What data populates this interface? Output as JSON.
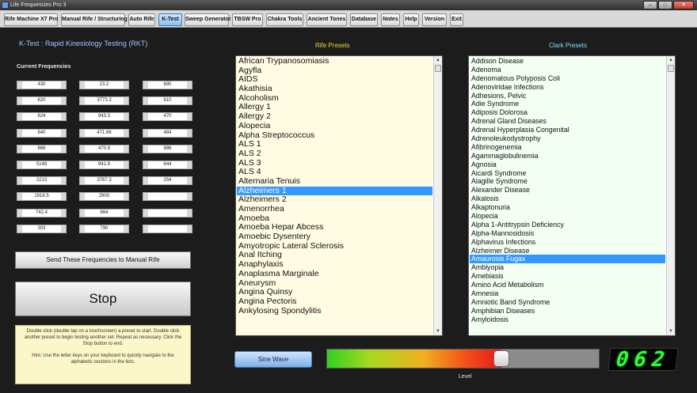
{
  "window": {
    "title": "Life Frequencies Pro 3",
    "minimize": "–",
    "maximize": "□",
    "close": "✕"
  },
  "tabs": [
    {
      "label": "Rife Machine X7 Pro"
    },
    {
      "label": "Manual Rife / Structuring"
    },
    {
      "label": "Auto Rife"
    },
    {
      "label": "K-Test",
      "active": true
    },
    {
      "label": "Sweep Generator"
    },
    {
      "label": "TBSW Pro"
    },
    {
      "label": "Chakra Tools"
    },
    {
      "label": "Ancient Tones"
    },
    {
      "label": "Database"
    },
    {
      "label": "Notes"
    },
    {
      "label": "Help"
    },
    {
      "label": "Version"
    },
    {
      "label": "Exit"
    }
  ],
  "ktest": {
    "title": "K-Test : Rapid Kinesiology Testing (RKT)",
    "current_freq_label": "Current Frequencies",
    "frequencies": [
      [
        "430",
        "23.2",
        "690"
      ],
      [
        "620",
        "3773.3",
        "610"
      ],
      [
        "624",
        "943.3",
        "470"
      ],
      [
        "840",
        "471.66",
        "484"
      ],
      [
        "866",
        "470.9",
        "986"
      ],
      [
        "5148",
        "941.8",
        "644"
      ],
      [
        "2213",
        "3767.3",
        "254"
      ],
      [
        "1918.5",
        "2900",
        ""
      ],
      [
        "742.4",
        "864",
        ""
      ],
      [
        "303",
        "790",
        ""
      ]
    ],
    "send_button": "Send These Frequencies to Manual Rife",
    "stop_button": "Stop",
    "hint_text_1": "Double click (double tap on a touchscreen) a preset to start. Double click another preset to begin testing another set. Repeat as necessary. Click the Stop button to end.",
    "hint_text_2": "Hint: Use the letter keys on your keyboard to quickly navigate to the alphabetic sections in the lists."
  },
  "rife_presets": {
    "title": "Rife Presets",
    "selected": "Alzheimers 1",
    "items": [
      "African Trypanosomiasis",
      "Agyfla",
      "AIDS",
      "Akathisia",
      "Alcoholism",
      "Allergy 1",
      "Allergy 2",
      "Alopecia",
      "Alpha Streptococcus",
      "ALS 1",
      "ALS 2",
      "ALS 3",
      "ALS 4",
      "Alternaria Tenuis",
      "Alzheimers 1",
      "Alzheimers 2",
      "Amenorrhea",
      "Amoeba",
      "Amoeba Hepar Abcess",
      "Amoebic Dysentery",
      "Amyotropic Lateral Sclerosis",
      "Anal Itching",
      "Anaphylaxis",
      "Anaplasma Marginale",
      "Aneurysm",
      "Angina Quinsy",
      "Angina Pectoris",
      "Ankylosing Spondylitis"
    ]
  },
  "clark_presets": {
    "title": "Clark Presets",
    "selected": "Amaurosis Fugax",
    "items": [
      "Addison Disease",
      "Adenoma",
      "Adenomatous Polyposis Coli",
      "Adenoviridae Infections",
      "Adhesions, Pelvic",
      "Adie Syndrome",
      "Adiposis Dolorosa",
      "Adrenal Gland Diseases",
      "Adrenal Hyperplasia Congenital",
      "Adrenoleukodystrophy",
      "Afibrinogenemia",
      "Agammaglobulinemia",
      "Agnosia",
      "Aicardi Syndrome",
      "Alagille Syndrome",
      "Alexander Disease",
      "Alkalosis",
      "Alkaptonuria",
      "Alopecia",
      "Alpha 1-Antitrypsin Deficiency",
      "Alpha-Mannosidosis",
      "Alphavirus Infections",
      "Alzheimer Disease",
      "Amaurosis Fugax",
      "Amblyopia",
      "Amebiasis",
      "Amino Acid Metabolism",
      "Amnesia",
      "Amniotic Band Syndrome",
      "Amphibian Diseases",
      "Amyloidosis"
    ]
  },
  "controls": {
    "waveform_button": "Sine Wave",
    "level_label": "Level",
    "level_fraction": 0.64,
    "level_display": "062"
  },
  "colors": {
    "accent_blue": "#3399ff",
    "rife_title": "#f4d83a",
    "clark_title": "#7ee0ff",
    "led_green": "#2cff2c"
  }
}
